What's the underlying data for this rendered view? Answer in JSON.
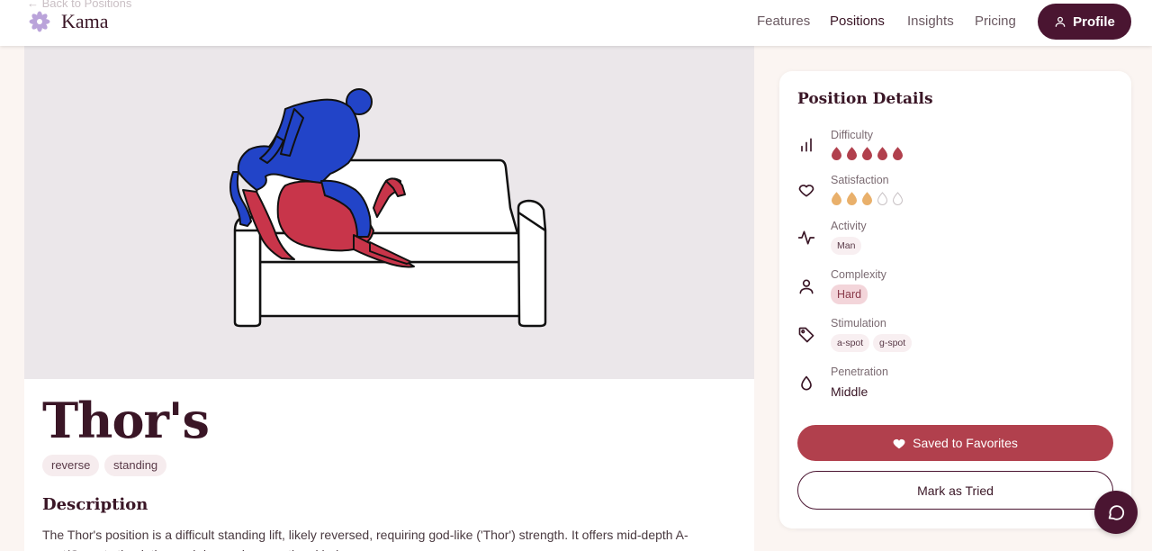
{
  "nav": {
    "back_link": "← Back to Positions",
    "logo": "Kama",
    "links": [
      "Features",
      "Positions",
      "Insights",
      "Pricing"
    ],
    "active": "Positions",
    "profile_label": "Profile"
  },
  "position": {
    "title": "Thor's",
    "tags": [
      "reverse",
      "standing"
    ],
    "description_heading": "Description",
    "description": "The Thor's position is a difficult standing lift, likely reversed, requiring god-like ('Thor') strength. It offers mid-depth A-spot/G-spot stimulation and demands exceptional balance."
  },
  "details": {
    "heading": "Position Details",
    "difficulty": {
      "label": "Difficulty",
      "value": 5,
      "max": 5,
      "icon": "bar-chart-icon",
      "color": "#b1404d"
    },
    "satisfaction": {
      "label": "Satisfaction",
      "value": 3,
      "max": 5,
      "icon": "heart-icon",
      "color": "#e9b06b"
    },
    "activity": {
      "label": "Activity",
      "value": "Man",
      "icon": "activity-icon"
    },
    "complexity": {
      "label": "Complexity",
      "value": "Hard",
      "icon": "user-icon"
    },
    "stimulation": {
      "label": "Stimulation",
      "values": [
        "a-spot",
        "g-spot"
      ],
      "icon": "tag-icon"
    },
    "penetration": {
      "label": "Penetration",
      "value": "Middle",
      "icon": "droplet-icon"
    }
  },
  "actions": {
    "saved_label": "Saved to Favorites",
    "tried_label": "Mark as Tried"
  },
  "colors": {
    "brand_dark": "#4a1531",
    "accent_red": "#b1404d",
    "accent_gold": "#e9b06b"
  }
}
